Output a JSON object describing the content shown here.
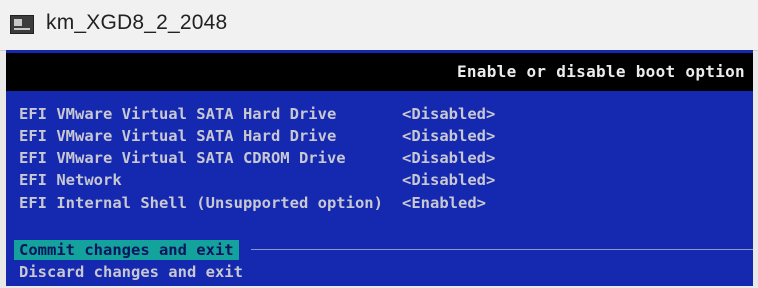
{
  "window": {
    "title": "km_XGD8_2_2048"
  },
  "header": {
    "help_text": "Enable or disable boot option"
  },
  "boot_options": [
    {
      "name": "EFI VMware Virtual SATA Hard Drive",
      "state": "<Disabled>"
    },
    {
      "name": "EFI VMware Virtual SATA Hard Drive",
      "state": "<Disabled>"
    },
    {
      "name": "EFI VMware Virtual SATA CDROM Drive",
      "state": "<Disabled>"
    },
    {
      "name": "EFI Network",
      "state": "<Disabled>"
    },
    {
      "name": "EFI Internal Shell (Unsupported option)",
      "state": "<Enabled>"
    }
  ],
  "actions": [
    {
      "label": "Commit changes and exit",
      "selected": true
    },
    {
      "label": "Discard changes and exit",
      "selected": false
    }
  ],
  "colors": {
    "screen_bg": "#1428b0",
    "header_bg": "#000000",
    "highlight": "#13a39c"
  }
}
